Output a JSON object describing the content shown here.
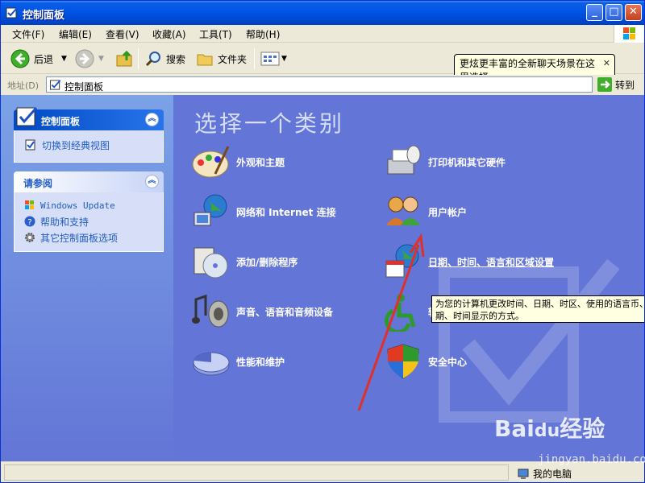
{
  "window": {
    "title": "控制面板"
  },
  "menu": [
    "文件(F)",
    "编辑(E)",
    "查看(V)",
    "收藏(A)",
    "工具(T)",
    "帮助(H)"
  ],
  "toolbar": {
    "back": "后退",
    "search": "搜索",
    "folders": "文件夹"
  },
  "address": {
    "label": "地址(D)",
    "value": "控制面板",
    "go": "转到"
  },
  "balloon": {
    "text": "更炫更丰富的全新聊天场景在这里选择"
  },
  "left_panel": {
    "panel1_title": "控制面板",
    "switch_view": "切换到经典视图",
    "panel2_title": "请参阅",
    "links": [
      "Windows Update",
      "帮助和支持",
      "其它控制面板选项"
    ]
  },
  "main": {
    "heading": "选择一个类别",
    "categories": [
      "外观和主题",
      "打印机和其它硬件",
      "网络和 Internet 连接",
      "用户帐户",
      "添加/删除程序",
      "日期、时间、语言和区域设置",
      "声音、语音和音频设备",
      "辅",
      "性能和维护",
      "安全中心"
    ],
    "tooltip": "为您的计算机更改时间、日期、时区、使用的语言币、日期、时间显示的方式。"
  },
  "status": {
    "computer": "我的电脑"
  },
  "watermark": {
    "brand": "Bai",
    "brand2": "经验",
    "sub": "jingyan.baidu.com"
  }
}
